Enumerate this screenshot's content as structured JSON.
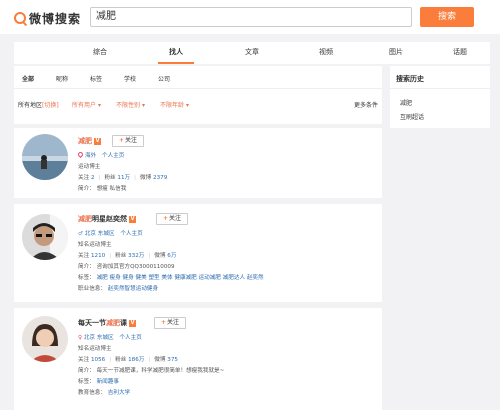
{
  "header": {
    "logo_text": "微博搜索",
    "search_value": "减肥",
    "search_button": "搜索"
  },
  "tabs": [
    "综合",
    "找人",
    "文章",
    "视频",
    "图片",
    "话题"
  ],
  "filter_tabs": [
    "全部",
    "昵称",
    "标签",
    "学校",
    "公司"
  ],
  "filters": {
    "region": "所有地区",
    "region_switch": "[切换]",
    "users": "所有用户",
    "gender": "不限性别",
    "age": "不限年龄",
    "more": "更多条件"
  },
  "sidebar": {
    "title": "搜索历史",
    "items": [
      "减肥",
      "互刷超话"
    ]
  },
  "results": [
    {
      "name_hl": "减肥",
      "name_rest": "",
      "follow": "关注",
      "loc": "海外",
      "home": "个人主页",
      "desc": "运动博主",
      "follows_label": "关注",
      "follows": "2",
      "fans_label": "粉丝",
      "fans": "11万",
      "weibo_label": "微博",
      "weibo": "2379",
      "bio_label": "简介：",
      "bio": "想瘦 私信我"
    },
    {
      "name_hl": "减肥",
      "name_rest": "明星赵奕然",
      "follow": "关注",
      "loc": "北京 东城区",
      "home": "个人主页",
      "desc": "知名运动博主",
      "follows_label": "关注",
      "follows": "1210",
      "fans_label": "粉丝",
      "fans": "332万",
      "weibo_label": "微博",
      "weibo": "6万",
      "bio_label": "简介：",
      "bio": "咨询加其官方QQ3000110009",
      "tags_label": "标签：",
      "tags": "减肥 瘦身 健身 健美 塑型 美体 健康减肥 运动减肥 减肥达人 赵奕然",
      "job_label": "职业信息：",
      "job": "赵奕然智慧运动健身"
    },
    {
      "name_pre": "每天一节",
      "name_hl": "减肥",
      "name_rest": "课",
      "follow": "关注",
      "loc": "北京 东城区",
      "home": "个人主页",
      "desc": "知名运动博主",
      "follows_label": "关注",
      "follows": "1056",
      "fans_label": "粉丝",
      "fans": "186万",
      "weibo_label": "微博",
      "weibo": "375",
      "bio_label": "简介：",
      "bio": "每天一节减肥课，科学减肥很简单！想瘦我我就是~",
      "tags_label": "标签：",
      "tags": "新闻趣事",
      "edu_label": "教育信息：",
      "edu": "吉利大学"
    }
  ]
}
